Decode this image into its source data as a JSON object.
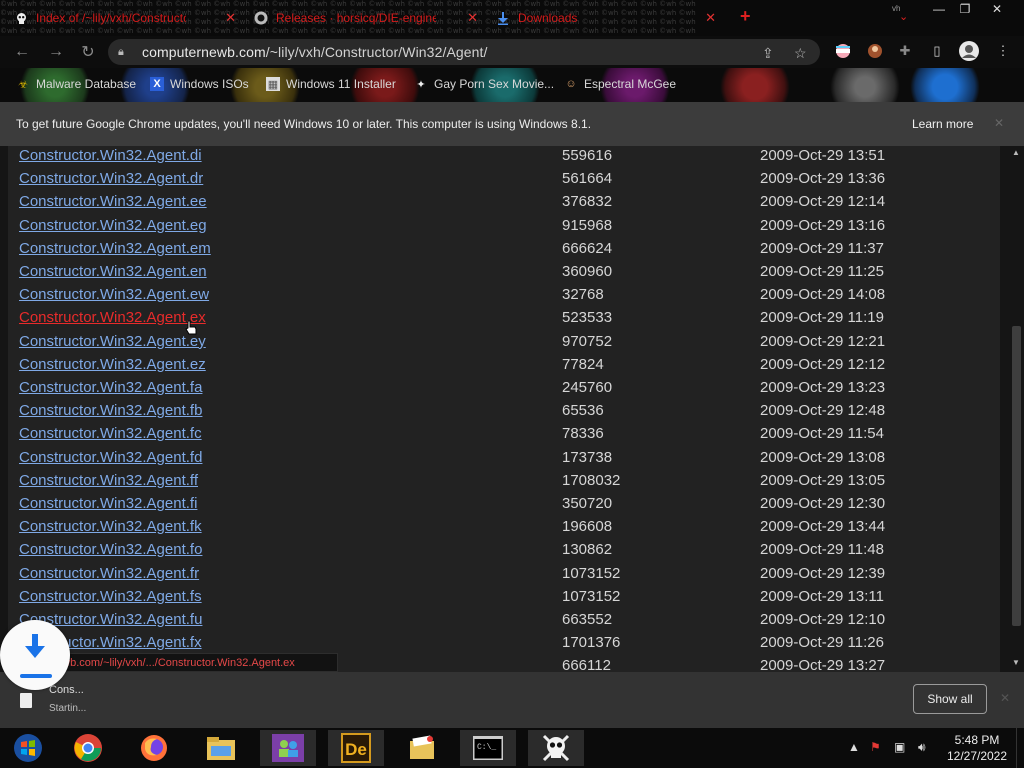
{
  "tabs": [
    {
      "label": "Index of /~lily/vxh/Constructor",
      "icon": "skull-icon",
      "active": true
    },
    {
      "label": "Releases · horsicq/DIE-engine",
      "icon": "github-icon",
      "active": false
    },
    {
      "label": "Downloads",
      "icon": "download-icon",
      "active": false
    }
  ],
  "address_bar": {
    "host": "computernewb.com",
    "path": "/~lily/vxh/Constructor/Win32/Agent/"
  },
  "bookmarks": [
    {
      "label": "Malware Database",
      "icon": "hazard-icon"
    },
    {
      "label": "Windows ISOs",
      "icon": "x-logo-icon"
    },
    {
      "label": "Windows 11 Installer",
      "icon": "image-icon"
    },
    {
      "label": "Gay Porn Sex Movie...",
      "icon": "site-icon"
    },
    {
      "label": "Espectral McGee",
      "icon": "avatar-icon"
    }
  ],
  "infobar": {
    "message": "To get future Google Chrome updates, you'll need Windows 10 or later. This computer is using Windows 8.1.",
    "action": "Learn more"
  },
  "listing": [
    {
      "name": "Constructor.Win32.Agent.di",
      "size": "559616",
      "date": "2009-Oct-29 13:51"
    },
    {
      "name": "Constructor.Win32.Agent.dr",
      "size": "561664",
      "date": "2009-Oct-29 13:36"
    },
    {
      "name": "Constructor.Win32.Agent.ee",
      "size": "376832",
      "date": "2009-Oct-29 12:14"
    },
    {
      "name": "Constructor.Win32.Agent.eg",
      "size": "915968",
      "date": "2009-Oct-29 13:16"
    },
    {
      "name": "Constructor.Win32.Agent.em",
      "size": "666624",
      "date": "2009-Oct-29 11:37"
    },
    {
      "name": "Constructor.Win32.Agent.en",
      "size": "360960",
      "date": "2009-Oct-29 11:25"
    },
    {
      "name": "Constructor.Win32.Agent.ew",
      "size": "32768",
      "date": "2009-Oct-29 14:08"
    },
    {
      "name": "Constructor.Win32.Agent.ex",
      "size": "523533",
      "date": "2009-Oct-29 11:19"
    },
    {
      "name": "Constructor.Win32.Agent.ey",
      "size": "970752",
      "date": "2009-Oct-29 12:21"
    },
    {
      "name": "Constructor.Win32.Agent.ez",
      "size": "77824",
      "date": "2009-Oct-29 12:12"
    },
    {
      "name": "Constructor.Win32.Agent.fa",
      "size": "245760",
      "date": "2009-Oct-29 13:23"
    },
    {
      "name": "Constructor.Win32.Agent.fb",
      "size": "65536",
      "date": "2009-Oct-29 12:48"
    },
    {
      "name": "Constructor.Win32.Agent.fc",
      "size": "78336",
      "date": "2009-Oct-29 11:54"
    },
    {
      "name": "Constructor.Win32.Agent.fd",
      "size": "173738",
      "date": "2009-Oct-29 13:08"
    },
    {
      "name": "Constructor.Win32.Agent.ff",
      "size": "1708032",
      "date": "2009-Oct-29 13:05"
    },
    {
      "name": "Constructor.Win32.Agent.fi",
      "size": "350720",
      "date": "2009-Oct-29 12:30"
    },
    {
      "name": "Constructor.Win32.Agent.fk",
      "size": "196608",
      "date": "2009-Oct-29 13:44"
    },
    {
      "name": "Constructor.Win32.Agent.fo",
      "size": "130862",
      "date": "2009-Oct-29 11:48"
    },
    {
      "name": "Constructor.Win32.Agent.fr",
      "size": "1073152",
      "date": "2009-Oct-29 12:39"
    },
    {
      "name": "Constructor.Win32.Agent.fs",
      "size": "1073152",
      "date": "2009-Oct-29 13:11"
    },
    {
      "name": "Constructor.Win32.Agent.fu",
      "size": "663552",
      "date": "2009-Oct-29 12:10"
    },
    {
      "name": "Constructor.Win32.Agent.fx",
      "size": "1701376",
      "date": "2009-Oct-29 11:26"
    },
    {
      "name": "",
      "size": "666112",
      "date": "2009-Oct-29 13:27"
    }
  ],
  "hovered_row": "Constructor.Win32.Agent.ex",
  "status_url": "...wb.com/~lily/vxh/.../Constructor.Win32.Agent.ex",
  "download_shelf": {
    "file_name": "Cons...",
    "status": "Startin...",
    "show_all": "Show all"
  },
  "taskbar": {
    "apps": [
      "windows-start-icon",
      "chrome-icon",
      "firefox-icon",
      "file-explorer-icon",
      "people-app-icon",
      "de-app-icon",
      "notes-icon",
      "terminal-icon",
      "skull-app-icon"
    ],
    "time": "5:48 PM",
    "date": "12/27/2022"
  },
  "colors": {
    "link": "#7fa9e6",
    "link_hover": "#e82b2b",
    "tab_text": "#d51b1b",
    "download_accent": "#1a73e8"
  }
}
